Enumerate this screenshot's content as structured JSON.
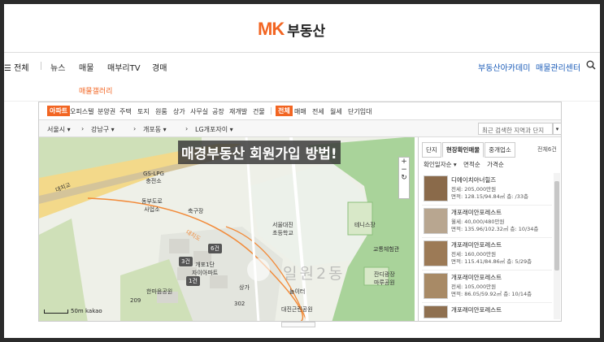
{
  "logo": {
    "mk": "MK",
    "brand": "부동산"
  },
  "gnb": {
    "all": "전체",
    "items": [
      "뉴스",
      "매물",
      "매부리TV",
      "경매"
    ],
    "right": [
      "부동산아카데미",
      "매물관리센터"
    ]
  },
  "subnav": {
    "gallery": "매물갤러리"
  },
  "filters": {
    "types": [
      "아파트",
      "오피스텔",
      "분양권",
      "주택",
      "토지",
      "원룸",
      "상가",
      "사무실",
      "공장",
      "재개발",
      "건물"
    ],
    "active_type": "아파트",
    "deals": [
      "전체",
      "매매",
      "전세",
      "월세",
      "단기임대"
    ],
    "active_deal": "전체"
  },
  "location": {
    "crumbs": [
      "서울시",
      "강남구",
      "개포동",
      "LG개포자이"
    ],
    "recent_placeholder": "최근 검색한 지역과 단지"
  },
  "map": {
    "banner": "매경부동산 회원가입 방법!",
    "labels": [
      "대치교",
      "GS-LPG\n충전소",
      "동부도로\n사업소",
      "축구장",
      "서울대진\n초등학교",
      "테니스장",
      "교통체험관",
      "잔디광장\n마루공원",
      "놀이터",
      "대진근린공원",
      "개포1단\n자이아파트",
      "상가",
      "한마음공원",
      "209",
      "302",
      "대치도"
    ],
    "tags": [
      "6건",
      "3건",
      "1건"
    ],
    "watermark": "일원2동",
    "scale": "50m",
    "provider": "kakao",
    "zoom": [
      "+",
      "−",
      "↻"
    ]
  },
  "panel": {
    "tabs": [
      "단지",
      "현장확인매물",
      "중개업소"
    ],
    "active_tab": "현장확인매물",
    "count": "전체6건",
    "sort": [
      "확인일자순 ▾",
      "면적순",
      "가격순"
    ],
    "listings": [
      {
        "name": "디에이치아너힐즈",
        "price": "전세: 205,000만원",
        "area": "면적: 128.15/94.84㎡ 층: /33층"
      },
      {
        "name": "개포래미안포레스트",
        "price": "월세: 40,000/480만원",
        "area": "면적: 135.96/102.32㎡ 층: 10/34층"
      },
      {
        "name": "개포래미안포레스트",
        "price": "전세: 160,000만원",
        "area": "면적: 115.41/84.86㎡ 층: 5/29층"
      },
      {
        "name": "개포래미안포레스트",
        "price": "전세: 105,000만원",
        "area": "면적: 86.05/59.92㎡ 층: 10/14층"
      },
      {
        "name": "개포래미안포레스트",
        "price": "",
        "area": ""
      }
    ]
  },
  "colors": {
    "accent": "#f26522",
    "link": "#1a5bb8"
  }
}
